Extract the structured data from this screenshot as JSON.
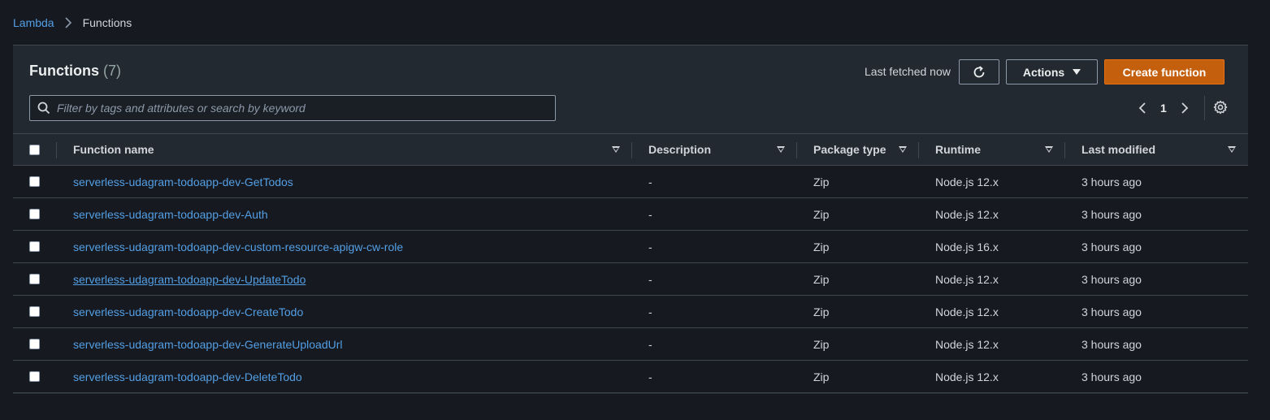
{
  "breadcrumb": {
    "parent": "Lambda",
    "current": "Functions"
  },
  "panel": {
    "title": "Functions",
    "count": "(7)",
    "last_fetched": "Last fetched now",
    "actions_label": "Actions",
    "create_label": "Create function",
    "search_placeholder": "Filter by tags and attributes or search by keyword",
    "page": "1"
  },
  "columns": {
    "name": "Function name",
    "description": "Description",
    "package_type": "Package type",
    "runtime": "Runtime",
    "last_modified": "Last modified"
  },
  "rows": [
    {
      "name": "serverless-udagram-todoapp-dev-GetTodos",
      "description": "-",
      "package_type": "Zip",
      "runtime": "Node.js 12.x",
      "last_modified": "3 hours ago"
    },
    {
      "name": "serverless-udagram-todoapp-dev-Auth",
      "description": "-",
      "package_type": "Zip",
      "runtime": "Node.js 12.x",
      "last_modified": "3 hours ago"
    },
    {
      "name": "serverless-udagram-todoapp-dev-custom-resource-apigw-cw-role",
      "description": "-",
      "package_type": "Zip",
      "runtime": "Node.js 16.x",
      "last_modified": "3 hours ago"
    },
    {
      "name": "serverless-udagram-todoapp-dev-UpdateTodo",
      "description": "-",
      "package_type": "Zip",
      "runtime": "Node.js 12.x",
      "last_modified": "3 hours ago"
    },
    {
      "name": "serverless-udagram-todoapp-dev-CreateTodo",
      "description": "-",
      "package_type": "Zip",
      "runtime": "Node.js 12.x",
      "last_modified": "3 hours ago"
    },
    {
      "name": "serverless-udagram-todoapp-dev-GenerateUploadUrl",
      "description": "-",
      "package_type": "Zip",
      "runtime": "Node.js 12.x",
      "last_modified": "3 hours ago"
    },
    {
      "name": "serverless-udagram-todoapp-dev-DeleteTodo",
      "description": "-",
      "package_type": "Zip",
      "runtime": "Node.js 12.x",
      "last_modified": "3 hours ago"
    }
  ],
  "colors": {
    "link": "#539fe5",
    "primary_button": "#c45f0e",
    "background": "#16191f",
    "panel": "#232930"
  }
}
